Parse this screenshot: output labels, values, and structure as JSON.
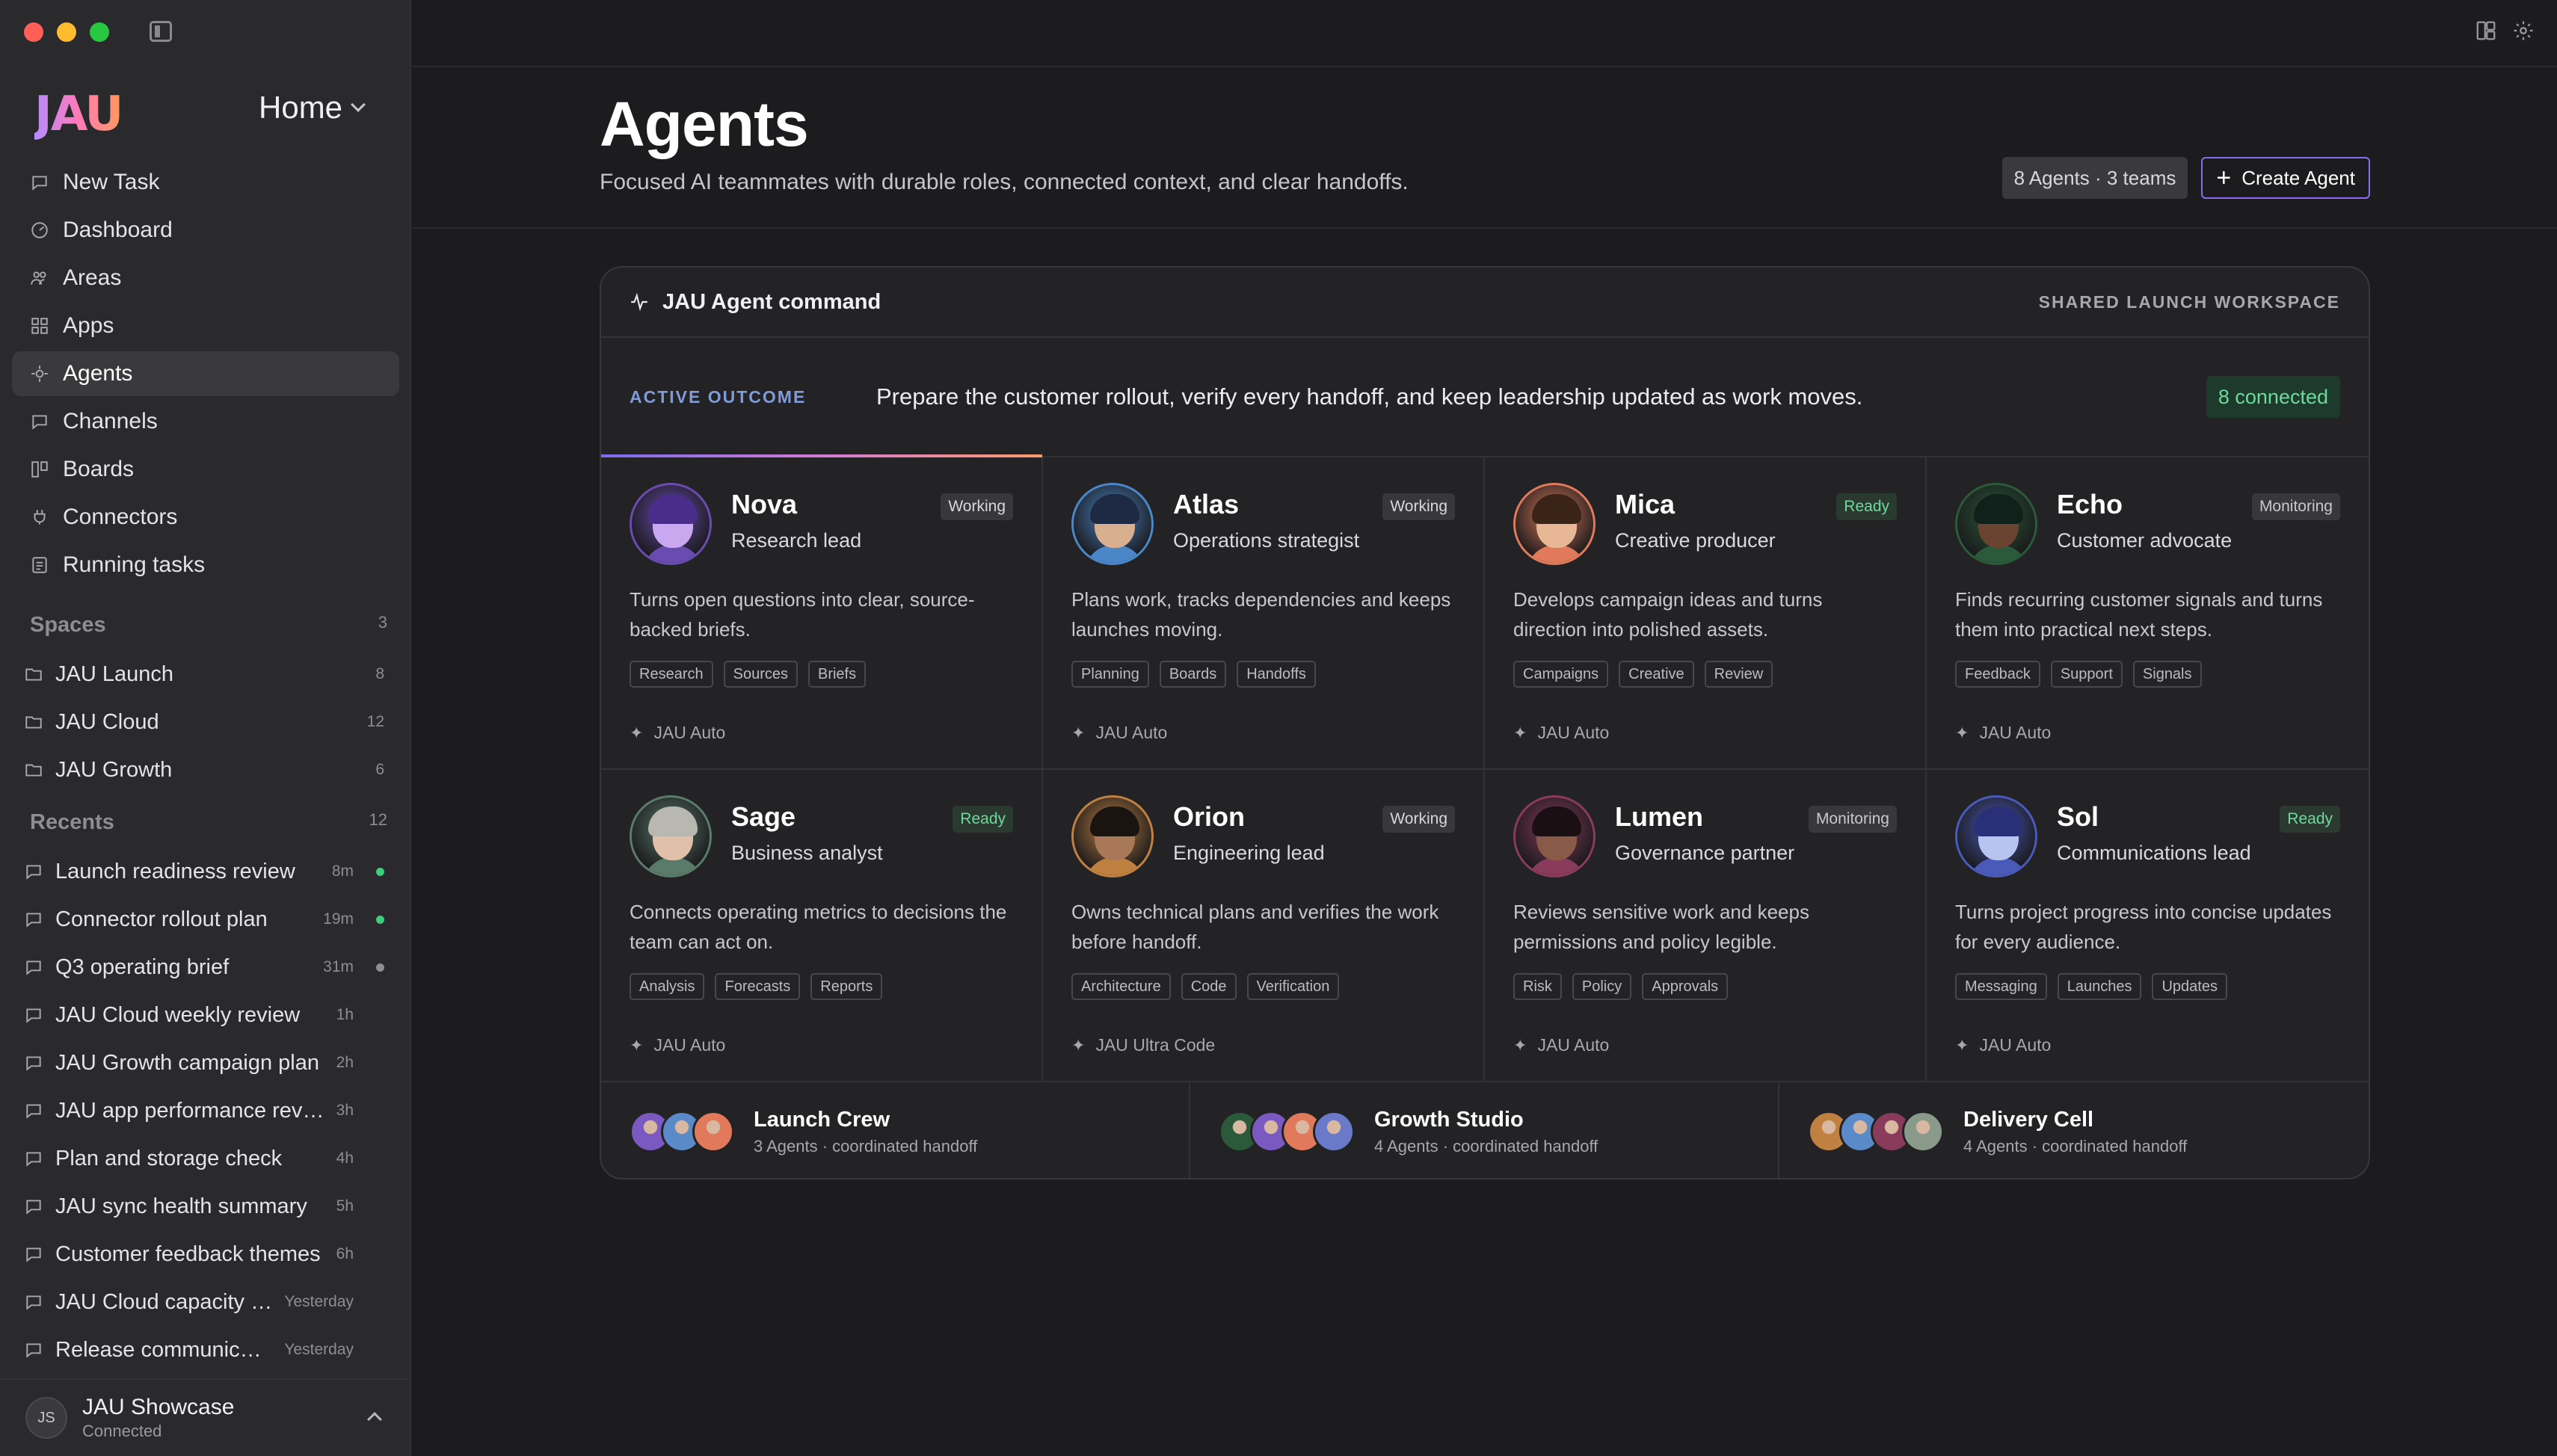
{
  "app": {
    "logo": "JAU",
    "workspace": "Home"
  },
  "nav": [
    {
      "label": "New Task",
      "icon": "chat-icon"
    },
    {
      "label": "Dashboard",
      "icon": "gauge-icon"
    },
    {
      "label": "Areas",
      "icon": "people-icon"
    },
    {
      "label": "Apps",
      "icon": "apps-icon"
    },
    {
      "label": "Agents",
      "icon": "agent-icon",
      "active": true
    },
    {
      "label": "Channels",
      "icon": "chat-icon"
    },
    {
      "label": "Boards",
      "icon": "board-icon"
    },
    {
      "label": "Connectors",
      "icon": "plug-icon"
    },
    {
      "label": "Running tasks",
      "icon": "tasks-icon"
    }
  ],
  "spaces": {
    "title": "Spaces",
    "count": "3",
    "items": [
      {
        "label": "JAU Launch",
        "count": "8"
      },
      {
        "label": "JAU Cloud",
        "count": "12"
      },
      {
        "label": "JAU Growth",
        "count": "6"
      }
    ]
  },
  "recents": {
    "title": "Recents",
    "count": "12",
    "items": [
      {
        "label": "Launch readiness review",
        "time": "8m",
        "dot": "g"
      },
      {
        "label": "Connector rollout plan",
        "time": "19m",
        "dot": "g"
      },
      {
        "label": "Q3 operating brief",
        "time": "31m",
        "dot": "gr"
      },
      {
        "label": "JAU Cloud weekly review",
        "time": "1h",
        "dot": "none"
      },
      {
        "label": "JAU Growth campaign plan",
        "time": "2h",
        "dot": "none"
      },
      {
        "label": "JAU app performance review",
        "time": "3h",
        "dot": "none"
      },
      {
        "label": "Plan and storage check",
        "time": "4h",
        "dot": "none"
      },
      {
        "label": "JAU sync health summary",
        "time": "5h",
        "dot": "none"
      },
      {
        "label": "Customer feedback themes",
        "time": "6h",
        "dot": "none"
      },
      {
        "label": "JAU Cloud capacity plan",
        "time": "Yesterday",
        "dot": "none"
      },
      {
        "label": "Release communicatio…",
        "time": "Yesterday",
        "dot": "none"
      }
    ]
  },
  "user": {
    "initials": "JS",
    "name": "JAU Showcase",
    "status": "Connected"
  },
  "header": {
    "title": "Agents",
    "subtitle": "Focused AI teammates with durable roles, connected context, and clear handoffs.",
    "stats": "8 Agents · 3 teams",
    "create_label": "Create Agent"
  },
  "command": {
    "title": "JAU Agent command",
    "tag": "SHARED LAUNCH WORKSPACE",
    "outcome_label": "ACTIVE OUTCOME",
    "outcome_text": "Prepare the customer rollout, verify every handoff, and keep leadership updated as work moves.",
    "connected": "8 connected"
  },
  "agents": [
    {
      "name": "Nova",
      "role": "Research lead",
      "status": "Working",
      "kind": "working",
      "desc": "Turns open questions into clear, source-backed briefs.",
      "tags": [
        "Research",
        "Sources",
        "Briefs"
      ],
      "model": "JAU Auto",
      "colors": [
        "#6a4bb0",
        "#c9a8f0",
        "#4a2d8a"
      ]
    },
    {
      "name": "Atlas",
      "role": "Operations strategist",
      "status": "Working",
      "kind": "working",
      "desc": "Plans work, tracks dependencies and keeps launches moving.",
      "tags": [
        "Planning",
        "Boards",
        "Handoffs"
      ],
      "model": "JAU Auto",
      "colors": [
        "#4a86c8",
        "#d8b090",
        "#1e2a44"
      ]
    },
    {
      "name": "Mica",
      "role": "Creative producer",
      "status": "Ready",
      "kind": "ready",
      "desc": "Develops campaign ideas and turns direction into polished assets.",
      "tags": [
        "Campaigns",
        "Creative",
        "Review"
      ],
      "model": "JAU Auto",
      "colors": [
        "#e07a5a",
        "#e8b896",
        "#3a2418"
      ]
    },
    {
      "name": "Echo",
      "role": "Customer advocate",
      "status": "Monitoring",
      "kind": "monitoring",
      "desc": "Finds recurring customer signals and turns them into practical next steps.",
      "tags": [
        "Feedback",
        "Support",
        "Signals"
      ],
      "model": "JAU Auto",
      "colors": [
        "#2a5a3a",
        "#6a4430",
        "#10201a"
      ]
    },
    {
      "name": "Sage",
      "role": "Business analyst",
      "status": "Ready",
      "kind": "ready",
      "desc": "Connects operating metrics to decisions the team can act on.",
      "tags": [
        "Analysis",
        "Forecasts",
        "Reports"
      ],
      "model": "JAU Auto",
      "colors": [
        "#5a7a6a",
        "#e0c0a8",
        "#b8b8b0"
      ]
    },
    {
      "name": "Orion",
      "role": "Engineering lead",
      "status": "Working",
      "kind": "working",
      "desc": "Owns technical plans and verifies the work before handoff.",
      "tags": [
        "Architecture",
        "Code",
        "Verification"
      ],
      "model": "JAU Ultra Code",
      "colors": [
        "#c08040",
        "#a87858",
        "#1a1410"
      ]
    },
    {
      "name": "Lumen",
      "role": "Governance partner",
      "status": "Monitoring",
      "kind": "monitoring",
      "desc": "Reviews sensitive work and keeps permissions and policy legible.",
      "tags": [
        "Risk",
        "Policy",
        "Approvals"
      ],
      "model": "JAU Auto",
      "colors": [
        "#8a3a5a",
        "#8a5a48",
        "#1a1014"
      ]
    },
    {
      "name": "Sol",
      "role": "Communications lead",
      "status": "Ready",
      "kind": "ready",
      "desc": "Turns project progress into concise updates for every audience.",
      "tags": [
        "Messaging",
        "Launches",
        "Updates"
      ],
      "model": "JAU Auto",
      "colors": [
        "#4a5ab8",
        "#b8c4f0",
        "#2a3078"
      ]
    }
  ],
  "teams": [
    {
      "name": "Launch Crew",
      "meta": "3 Agents · coordinated handoff",
      "avatars": [
        "#7a5ac0",
        "#5a8ac8",
        "#e07a5a"
      ]
    },
    {
      "name": "Growth Studio",
      "meta": "4 Agents · coordinated handoff",
      "avatars": [
        "#2a5a3a",
        "#7a5ac0",
        "#e07a5a",
        "#6a7ac8"
      ]
    },
    {
      "name": "Delivery Cell",
      "meta": "4 Agents · coordinated handoff",
      "avatars": [
        "#c08040",
        "#5a8ac8",
        "#8a3a5a",
        "#8a9a8a"
      ]
    }
  ]
}
